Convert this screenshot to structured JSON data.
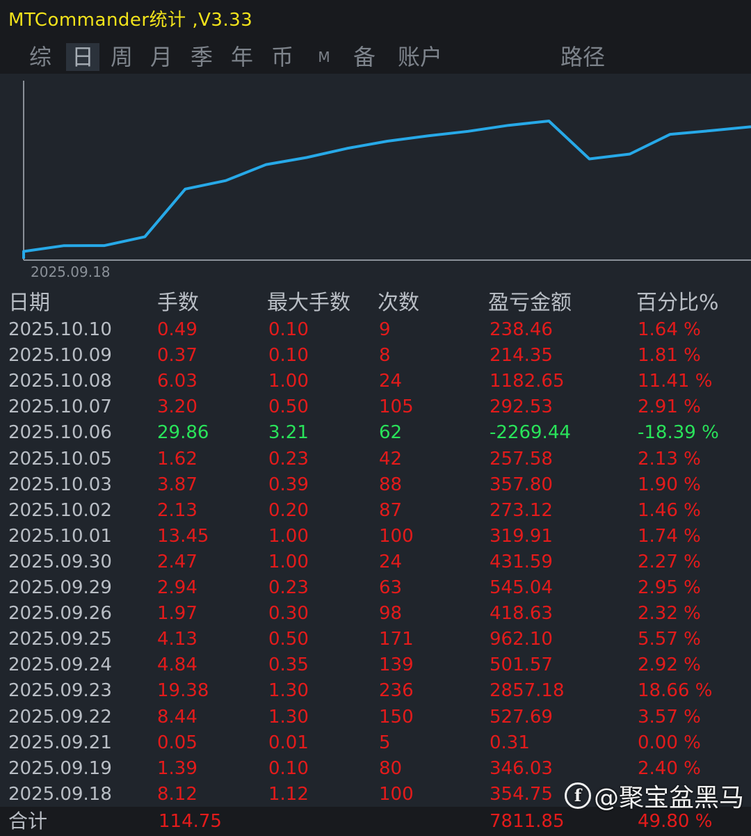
{
  "title": "MTCommander统计 ,V3.33",
  "tabs": [
    "综",
    "日",
    "周",
    "月",
    "季",
    "年",
    "币",
    "M",
    "备",
    "账户",
    "路径"
  ],
  "active_tab": "日",
  "chart": {
    "start_date_label": "2025.09.18",
    "line_color": "#27a9e8",
    "cumulative_pl": [
      354.75,
      700.78,
      702.78,
      1229.78,
      4086.96,
      4588.53,
      5550.63,
      5969.26,
      6514.3,
      6945.89,
      7265.8,
      7538.92,
      7896.72,
      8154.3,
      5884.86,
      6177.39,
      7360.04,
      7574.39,
      7812.85
    ]
  },
  "table": {
    "headers": [
      "日期",
      "手数",
      "最大手数",
      "次数",
      "盈亏金额",
      "百分比%"
    ],
    "rows": [
      {
        "date": "2025.10.10",
        "lots": "0.49",
        "max_lots": "0.10",
        "count": "9",
        "pl": "238.46",
        "pct": "1.64 %"
      },
      {
        "date": "2025.10.09",
        "lots": "0.37",
        "max_lots": "0.10",
        "count": "8",
        "pl": "214.35",
        "pct": "1.81 %"
      },
      {
        "date": "2025.10.08",
        "lots": "6.03",
        "max_lots": "1.00",
        "count": "24",
        "pl": "1182.65",
        "pct": "11.41 %"
      },
      {
        "date": "2025.10.07",
        "lots": "3.20",
        "max_lots": "0.50",
        "count": "105",
        "pl": "292.53",
        "pct": "2.91 %"
      },
      {
        "date": "2025.10.06",
        "lots": "29.86",
        "max_lots": "3.21",
        "count": "62",
        "pl": "-2269.44",
        "pct": "-18.39 %"
      },
      {
        "date": "2025.10.05",
        "lots": "1.62",
        "max_lots": "0.23",
        "count": "42",
        "pl": "257.58",
        "pct": "2.13 %"
      },
      {
        "date": "2025.10.03",
        "lots": "3.87",
        "max_lots": "0.39",
        "count": "88",
        "pl": "357.80",
        "pct": "1.90 %"
      },
      {
        "date": "2025.10.02",
        "lots": "2.13",
        "max_lots": "0.20",
        "count": "87",
        "pl": "273.12",
        "pct": "1.46 %"
      },
      {
        "date": "2025.10.01",
        "lots": "13.45",
        "max_lots": "1.00",
        "count": "100",
        "pl": "319.91",
        "pct": "1.74 %"
      },
      {
        "date": "2025.09.30",
        "lots": "2.47",
        "max_lots": "1.00",
        "count": "24",
        "pl": "431.59",
        "pct": "2.27 %"
      },
      {
        "date": "2025.09.29",
        "lots": "2.94",
        "max_lots": "0.23",
        "count": "63",
        "pl": "545.04",
        "pct": "2.95 %"
      },
      {
        "date": "2025.09.26",
        "lots": "1.97",
        "max_lots": "0.30",
        "count": "98",
        "pl": "418.63",
        "pct": "2.32 %"
      },
      {
        "date": "2025.09.25",
        "lots": "4.13",
        "max_lots": "0.50",
        "count": "171",
        "pl": "962.10",
        "pct": "5.57 %"
      },
      {
        "date": "2025.09.24",
        "lots": "4.84",
        "max_lots": "0.35",
        "count": "139",
        "pl": "501.57",
        "pct": "2.92 %"
      },
      {
        "date": "2025.09.23",
        "lots": "19.38",
        "max_lots": "1.30",
        "count": "236",
        "pl": "2857.18",
        "pct": "18.66 %"
      },
      {
        "date": "2025.09.22",
        "lots": "8.44",
        "max_lots": "1.30",
        "count": "150",
        "pl": "527.69",
        "pct": "3.57 %"
      },
      {
        "date": "2025.09.21",
        "lots": "0.05",
        "max_lots": "0.01",
        "count": "5",
        "pl": "0.31",
        "pct": "0.00 %"
      },
      {
        "date": "2025.09.19",
        "lots": "1.39",
        "max_lots": "0.10",
        "count": "80",
        "pl": "346.03",
        "pct": "2.40 %"
      },
      {
        "date": "2025.09.18",
        "lots": "8.12",
        "max_lots": "1.12",
        "count": "100",
        "pl": "354.75",
        "pct": ""
      }
    ],
    "total": {
      "label": "合计",
      "lots": "114.75",
      "pl": "7811.85",
      "pct": "49.80 %"
    }
  },
  "watermark": {
    "icon": "facebook-icon",
    "text": "@聚宝盆黑马"
  },
  "colors": {
    "profit": "#e31b1b",
    "loss": "#29e35a",
    "title": "#f1e21b"
  }
}
